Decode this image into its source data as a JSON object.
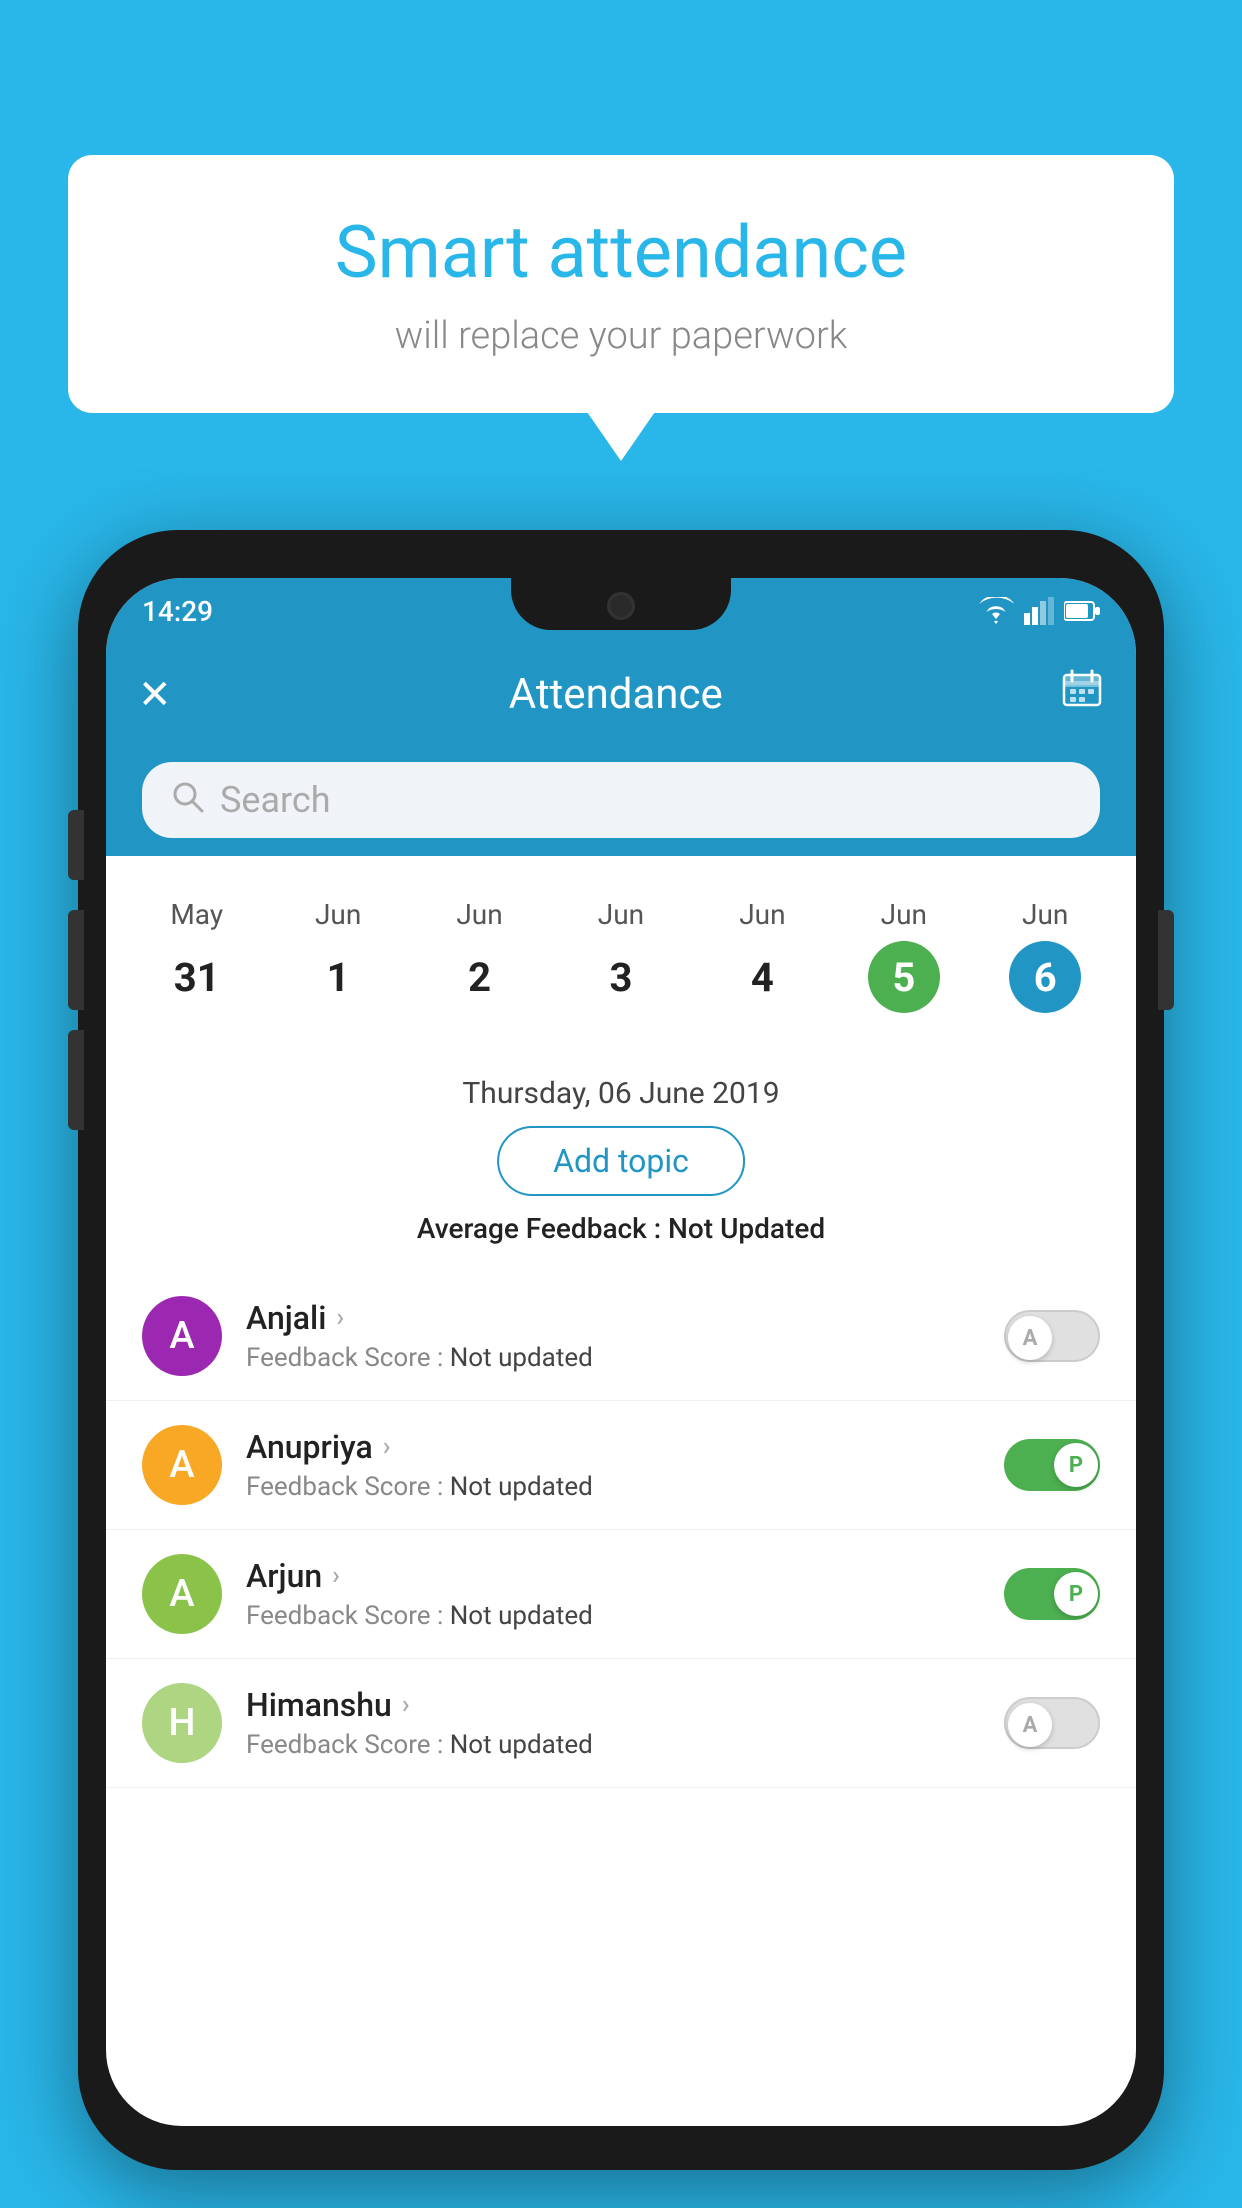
{
  "page": {
    "background_color": "#29b6e8"
  },
  "bubble": {
    "title": "Smart attendance",
    "subtitle": "will replace your paperwork"
  },
  "status_bar": {
    "time": "14:29"
  },
  "app_bar": {
    "title": "Attendance",
    "close_icon": "✕",
    "calendar_icon": "📅"
  },
  "search": {
    "placeholder": "Search"
  },
  "calendar": {
    "days": [
      {
        "month": "May",
        "num": "31",
        "state": "normal"
      },
      {
        "month": "Jun",
        "num": "1",
        "state": "normal"
      },
      {
        "month": "Jun",
        "num": "2",
        "state": "normal"
      },
      {
        "month": "Jun",
        "num": "3",
        "state": "normal"
      },
      {
        "month": "Jun",
        "num": "4",
        "state": "normal"
      },
      {
        "month": "Jun",
        "num": "5",
        "state": "today"
      },
      {
        "month": "Jun",
        "num": "6",
        "state": "selected"
      }
    ]
  },
  "selected_date": "Thursday, 06 June 2019",
  "add_topic_label": "Add topic",
  "avg_feedback_label": "Average Feedback :",
  "avg_feedback_value": "Not Updated",
  "students": [
    {
      "name": "Anjali",
      "avatar_letter": "A",
      "avatar_color": "#9c27b0",
      "feedback_label": "Feedback Score :",
      "feedback_value": "Not updated",
      "toggle_state": "off",
      "toggle_letter": "A"
    },
    {
      "name": "Anupriya",
      "avatar_letter": "A",
      "avatar_color": "#f9a825",
      "feedback_label": "Feedback Score :",
      "feedback_value": "Not updated",
      "toggle_state": "on",
      "toggle_letter": "P"
    },
    {
      "name": "Arjun",
      "avatar_letter": "A",
      "avatar_color": "#8bc34a",
      "feedback_label": "Feedback Score :",
      "feedback_value": "Not updated",
      "toggle_state": "on",
      "toggle_letter": "P"
    },
    {
      "name": "Himanshu",
      "avatar_letter": "H",
      "avatar_color": "#aed581",
      "feedback_label": "Feedback Score :",
      "feedback_value": "Not updated",
      "toggle_state": "off",
      "toggle_letter": "A"
    }
  ]
}
